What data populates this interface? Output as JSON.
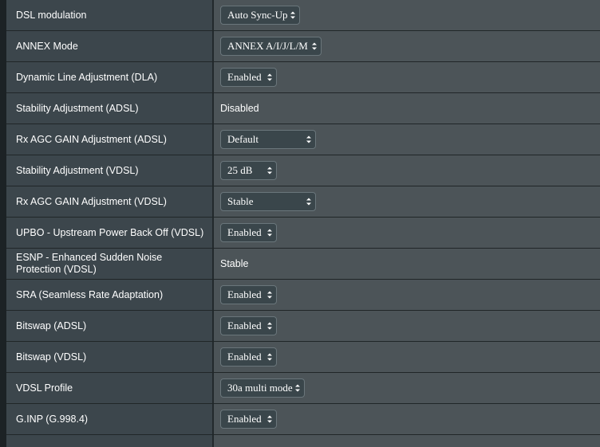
{
  "settings": [
    {
      "label": "DSL modulation",
      "type": "select",
      "value": "Auto Sync-Up"
    },
    {
      "label": "ANNEX Mode",
      "type": "select",
      "value": "ANNEX A/I/J/L/M"
    },
    {
      "label": "Dynamic Line Adjustment (DLA)",
      "type": "select",
      "value": "Enabled"
    },
    {
      "label": "Stability Adjustment (ADSL)",
      "type": "text",
      "value": "Disabled"
    },
    {
      "label": "Rx AGC GAIN Adjustment (ADSL)",
      "type": "select",
      "value": "Default"
    },
    {
      "label": "Stability Adjustment (VDSL)",
      "type": "select",
      "value": "25 dB"
    },
    {
      "label": "Rx AGC GAIN Adjustment (VDSL)",
      "type": "select",
      "value": "Stable"
    },
    {
      "label": "UPBO - Upstream Power Back Off (VDSL)",
      "type": "select",
      "value": "Enabled"
    },
    {
      "label": "ESNP - Enhanced Sudden Noise Protection (VDSL)",
      "type": "text",
      "value": "Stable"
    },
    {
      "label": "SRA (Seamless Rate Adaptation)",
      "type": "select",
      "value": "Enabled"
    },
    {
      "label": "Bitswap (ADSL)",
      "type": "select",
      "value": "Enabled"
    },
    {
      "label": "Bitswap (VDSL)",
      "type": "select",
      "value": "Enabled"
    },
    {
      "label": "VDSL Profile",
      "type": "select",
      "value": "30a multi mode"
    },
    {
      "label": "G.INP (G.998.4)",
      "type": "select",
      "value": "Enabled"
    },
    {
      "label": "",
      "type": "select",
      "value": ""
    }
  ],
  "colors": {
    "label_bg": "#3c464c",
    "value_bg": "#4c5458",
    "select_bg": "#3a464b",
    "page_bg": "#1c2225"
  }
}
